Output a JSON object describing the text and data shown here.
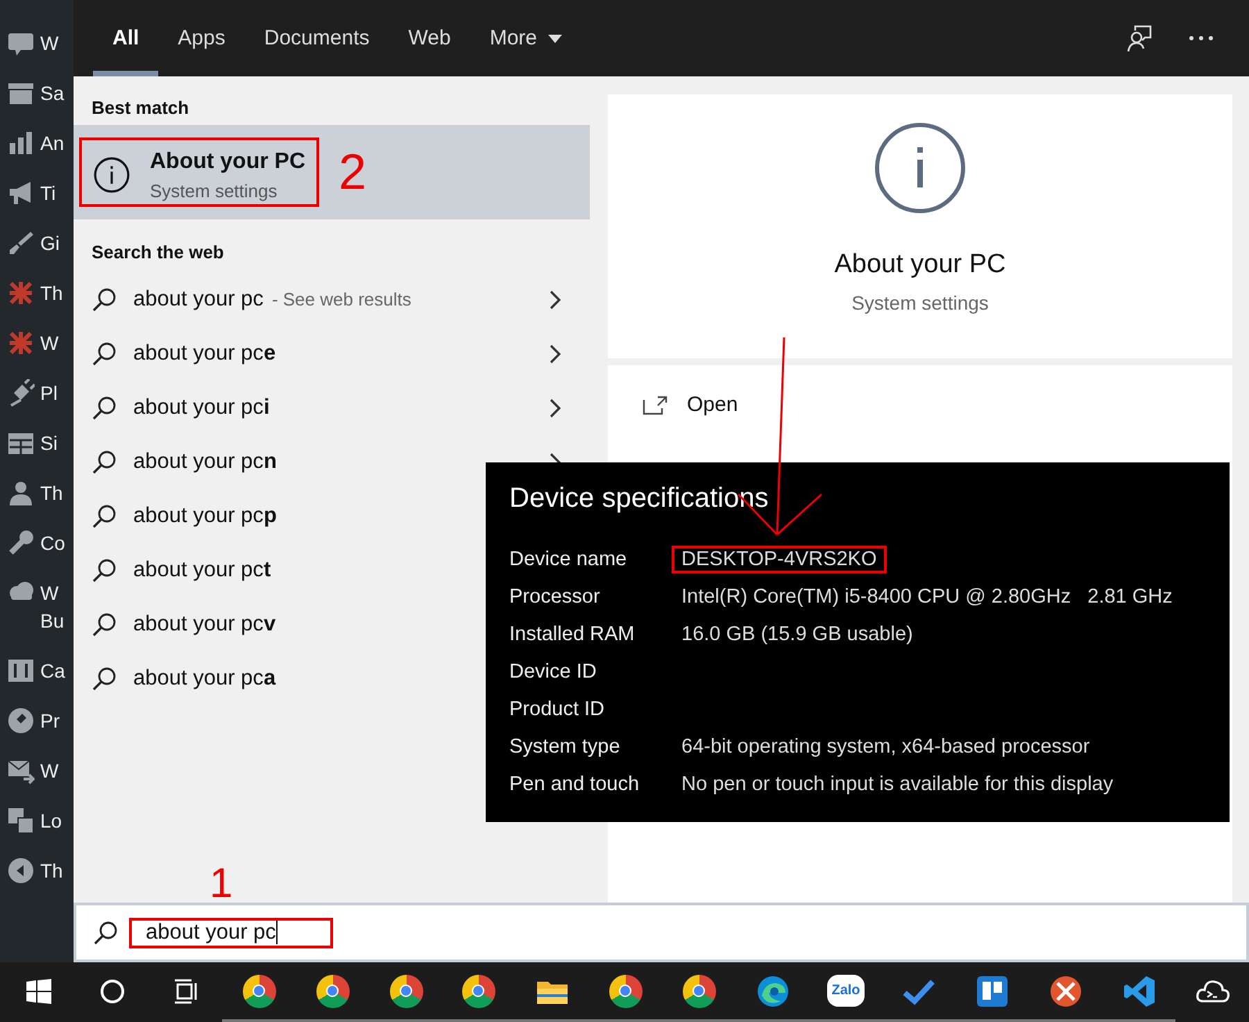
{
  "sidebar": {
    "items": [
      {
        "label": "W",
        "kind": "woo"
      },
      {
        "label": "Sa",
        "kind": "archive"
      },
      {
        "label": "An",
        "kind": "chart"
      },
      {
        "label": "Ti",
        "kind": "megaphone"
      },
      {
        "label": "Gi",
        "kind": "brush"
      },
      {
        "label": "Th",
        "kind": "cross"
      },
      {
        "label": "W",
        "kind": "cross"
      },
      {
        "label": "Pl",
        "kind": "plug"
      },
      {
        "label": "Si",
        "kind": "table"
      },
      {
        "label": "Th",
        "kind": "person"
      },
      {
        "label": "Co",
        "kind": "wrench"
      },
      {
        "label": "W",
        "label_2": "Bu",
        "kind": "cloud"
      },
      {
        "label": "Ca",
        "kind": "sliders"
      },
      {
        "label": "Pr",
        "kind": "tag"
      },
      {
        "label": "W",
        "kind": "mail"
      },
      {
        "label": "Lo",
        "kind": "translate"
      },
      {
        "label": "Th",
        "kind": "play"
      }
    ]
  },
  "tabs": [
    {
      "label": "All",
      "selected": true
    },
    {
      "label": "Apps",
      "selected": false
    },
    {
      "label": "Documents",
      "selected": false
    },
    {
      "label": "Web",
      "selected": false
    },
    {
      "label": "More",
      "selected": false,
      "dropdown": true
    }
  ],
  "best_match": {
    "heading": "Best match",
    "title": "About your PC",
    "subtitle": "System settings",
    "selected": true,
    "highlighted": true,
    "annotation": "2"
  },
  "web_search": {
    "heading": "Search the web",
    "items": [
      {
        "text": "about your pc",
        "hint": "- See web results",
        "arrow": true
      },
      {
        "text": "about your pc**e**",
        "arrow": true
      },
      {
        "text": "about your pc**i**",
        "arrow": true
      },
      {
        "text": "about your pc**n**",
        "arrow": true
      },
      {
        "text": "about your pc**p**",
        "arrow": false
      },
      {
        "text": "about your pc**t**",
        "arrow": false
      },
      {
        "text": "about your pc**v**",
        "arrow": false
      },
      {
        "text": "about your pc**a**",
        "arrow": false
      }
    ]
  },
  "preview": {
    "title": "About your PC",
    "subtitle": "System settings",
    "actions": [
      {
        "label": "Open"
      }
    ]
  },
  "device_specs": {
    "title": "Device specifications",
    "rows": [
      {
        "label": "Device name",
        "value": "DESKTOP-4VRS2KO",
        "highlighted": true
      },
      {
        "label": "Processor",
        "value": "Intel(R) Core(TM) i5-8400 CPU @ 2.80GHz",
        "value_2": "2.81 GHz"
      },
      {
        "label": "Installed RAM",
        "value": "16.0 GB (15.9 GB usable)"
      },
      {
        "label": "Device ID"
      },
      {
        "label": "Product ID"
      },
      {
        "label": "System type",
        "value": "64-bit operating system, x64-based processor"
      },
      {
        "label": "Pen and touch",
        "value": "No pen or touch input is available for this display"
      }
    ]
  },
  "search_box": {
    "value": "about your pc",
    "annotation": "1"
  },
  "taskbar": {
    "items": [
      {
        "kind": "start",
        "running": false
      },
      {
        "kind": "cortana",
        "running": false
      },
      {
        "kind": "taskview",
        "running": false
      },
      {
        "kind": "chrome",
        "running": true
      },
      {
        "kind": "chrome",
        "running": true
      },
      {
        "kind": "chrome",
        "running": true
      },
      {
        "kind": "chrome",
        "running": true
      },
      {
        "kind": "folder",
        "running": true
      },
      {
        "kind": "chrome",
        "running": true
      },
      {
        "kind": "chrome",
        "running": true
      },
      {
        "kind": "edge",
        "running": true
      },
      {
        "kind": "zalo",
        "label": "Zalo",
        "running": true
      },
      {
        "kind": "check",
        "running": true
      },
      {
        "kind": "trello",
        "running": true
      },
      {
        "kind": "remote",
        "running": true
      },
      {
        "kind": "vscode",
        "running": true
      },
      {
        "kind": "cloud",
        "running": false
      }
    ]
  }
}
